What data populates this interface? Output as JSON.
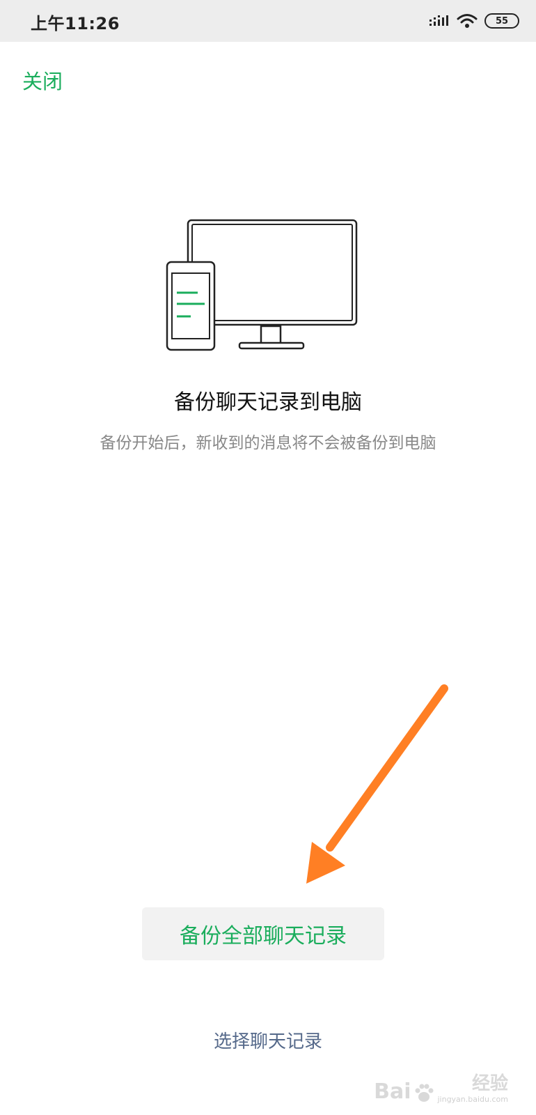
{
  "status_bar": {
    "time": "上午11:26",
    "battery": "55",
    "icons": [
      "signal-icon",
      "wifi-icon",
      "battery-icon"
    ]
  },
  "header": {
    "close_label": "关闭"
  },
  "illustration": {
    "icon": "phone-to-computer-icon",
    "accent_color": "#1aad5c"
  },
  "main": {
    "title": "备份聊天记录到电脑",
    "description": "备份开始后，新收到的消息将不会被备份到电脑"
  },
  "actions": {
    "backup_all_label": "备份全部聊天记录",
    "select_chats_label": "选择聊天记录"
  },
  "annotation": {
    "icon": "orange-arrow-icon",
    "color": "#ff7f24"
  },
  "watermark": {
    "brand": "Bai",
    "brand_cn": "经验",
    "site": "jingyan.baidu.com"
  },
  "colors": {
    "accent": "#1aad5c",
    "link": "#55698a",
    "status_bg": "#ededed",
    "button_bg": "#f2f2f2"
  }
}
